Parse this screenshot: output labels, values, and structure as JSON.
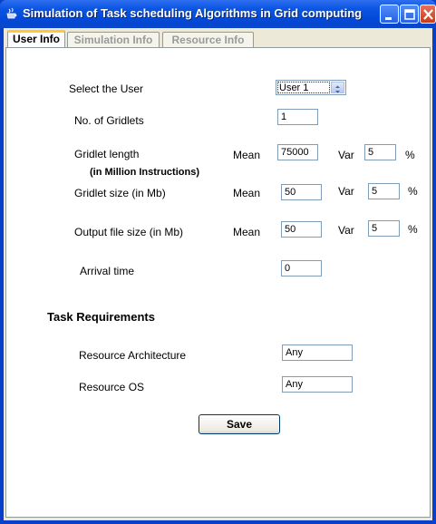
{
  "window": {
    "title": "Simulation of Task scheduling Algorithms in Grid computing"
  },
  "tabs": [
    {
      "label": "User Info",
      "active": true
    },
    {
      "label": "Simulation Info",
      "active": false
    },
    {
      "label": "Resource Info",
      "active": false
    }
  ],
  "form": {
    "select_user_label": "Select the User",
    "selected_user": "User 1",
    "num_gridlets_label": "No. of Gridlets",
    "num_gridlets_value": "1",
    "gridlet_length_label": "Gridlet length",
    "gridlet_length_note": "(in Million Instructions)",
    "gridlet_length_mean": "75000",
    "gridlet_length_var": "5",
    "gridlet_size_label": "Gridlet size (in Mb)",
    "gridlet_size_mean": "50",
    "gridlet_size_var": "5",
    "output_size_label": "Output file size (in Mb)",
    "output_size_mean": "50",
    "output_size_var": "5",
    "mean_label": "Mean",
    "var_label": "Var",
    "percent_label": "%",
    "arrival_time_label": "Arrival time",
    "arrival_time_value": "0"
  },
  "task_requirements": {
    "heading": "Task Requirements",
    "architecture_label": "Resource Architecture",
    "architecture_value": "Any",
    "os_label": "Resource OS",
    "os_value": "Any"
  },
  "actions": {
    "save_label": "Save"
  }
}
